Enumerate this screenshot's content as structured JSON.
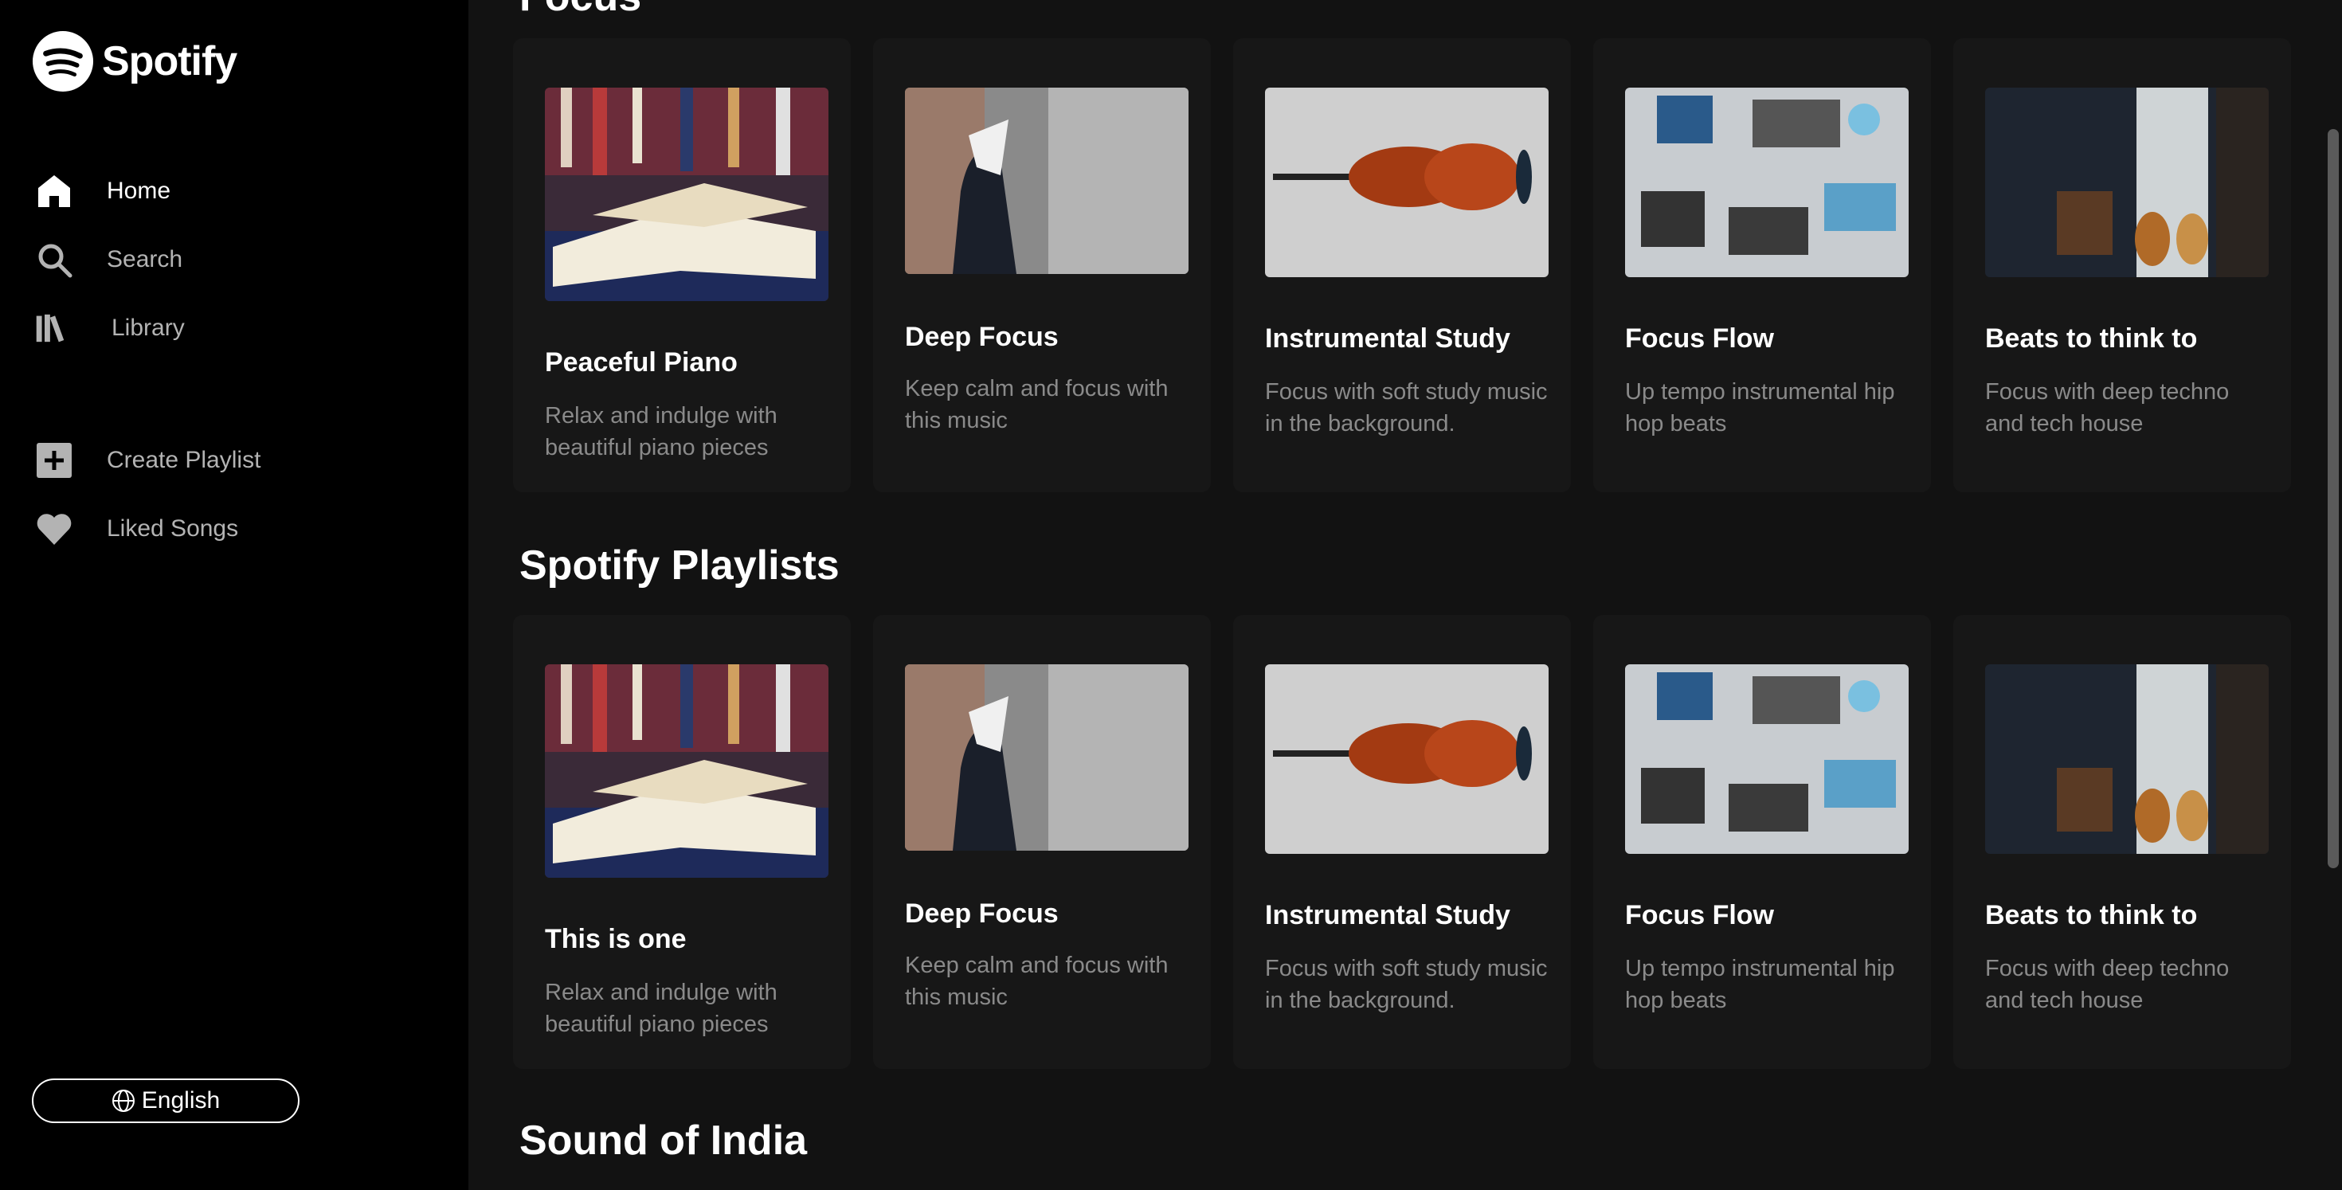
{
  "brand": {
    "name": "Spotify",
    "accent": "#1DB954"
  },
  "sidebar": {
    "nav": [
      {
        "label": "Home",
        "icon": "home-icon",
        "active": true
      },
      {
        "label": "Search",
        "icon": "search-icon"
      },
      {
        "label": "Library",
        "icon": "library-icon"
      }
    ],
    "actions": [
      {
        "label": "Create Playlist",
        "icon": "plus-square-icon"
      },
      {
        "label": "Liked Songs",
        "icon": "heart-icon"
      }
    ],
    "language": {
      "label": "English",
      "icon": "globe-icon"
    }
  },
  "sections": [
    {
      "title": "Focus",
      "cards": [
        {
          "title": "Peaceful Piano",
          "description": "Relax and indulge with beautiful piano pieces",
          "image": "open-books-image"
        },
        {
          "title": "Deep Focus",
          "description": "Keep calm and focus with this music",
          "image": "person-with-book-on-face-image"
        },
        {
          "title": "Instrumental Study",
          "description": "Focus with soft study music in the background.",
          "image": "violin-image"
        },
        {
          "title": "Focus Flow",
          "description": "Up tempo instrumental hip hop beats",
          "image": "laptops-on-desk-image"
        },
        {
          "title": "Beats to think to",
          "description": "Focus with deep techno and tech house",
          "image": "guitars-in-room-image"
        }
      ]
    },
    {
      "title": "Spotify Playlists",
      "cards": [
        {
          "title": "This is one",
          "description": "Relax and indulge with beautiful piano pieces",
          "image": "open-books-image"
        },
        {
          "title": "Deep Focus",
          "description": "Keep calm and focus with this music",
          "image": "person-with-book-on-face-image"
        },
        {
          "title": "Instrumental Study",
          "description": "Focus with soft study music in the background.",
          "image": "violin-image"
        },
        {
          "title": "Focus Flow",
          "description": "Up tempo instrumental hip hop beats",
          "image": "laptops-on-desk-image"
        },
        {
          "title": "Beats to think to",
          "description": "Focus with deep techno and tech house",
          "image": "guitars-in-room-image"
        }
      ]
    },
    {
      "title": "Sound of India",
      "cards": []
    }
  ]
}
